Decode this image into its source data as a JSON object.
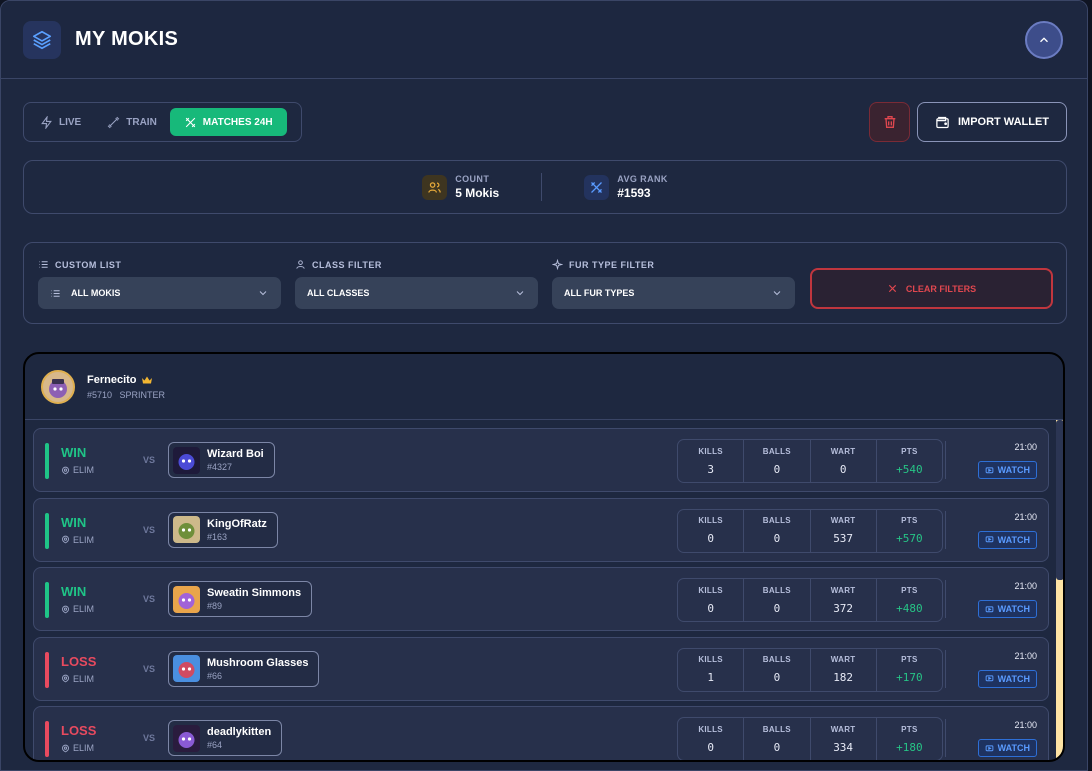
{
  "header": {
    "title": "MY MOKIS",
    "logo_icon": "layers-icon",
    "collapse_icon": "chevron-up-icon"
  },
  "toolbar": {
    "tabs": [
      {
        "label": "LIVE",
        "icon": "bolt-icon",
        "active": false
      },
      {
        "label": "TRAIN",
        "icon": "dumbbell-icon",
        "active": false
      },
      {
        "label": "MATCHES 24H",
        "icon": "swords-icon",
        "active": true
      }
    ],
    "delete_icon": "trash-icon",
    "import_label": "IMPORT WALLET",
    "import_icon": "wallet-icon"
  },
  "stats": {
    "count_label": "COUNT",
    "count_value": "5 Mokis",
    "rank_label": "AVG RANK",
    "rank_value": "#1593"
  },
  "filters": {
    "custom_list": {
      "label": "CUSTOM LIST",
      "value": "ALL MOKIS"
    },
    "class_filter": {
      "label": "CLASS FILTER",
      "value": "ALL CLASSES"
    },
    "fur_filter": {
      "label": "FUR TYPE FILTER",
      "value": "ALL FUR TYPES"
    },
    "clear_label": "CLEAR FILTERS"
  },
  "moki": {
    "name": "Fernecito",
    "id": "#5710",
    "class": "SPRINTER"
  },
  "columns": {
    "kills": "KILLS",
    "balls": "BALLS",
    "wart": "WART",
    "pts": "PTS"
  },
  "common": {
    "vs": "VS",
    "watch": "WATCH"
  },
  "matches": [
    {
      "result": "WIN",
      "mode": "ELIM",
      "opponent": "Wizard Boi",
      "opp_id": "#4327",
      "kills": "3",
      "balls": "0",
      "wart": "0",
      "pts": "+540",
      "time": "21:00"
    },
    {
      "result": "WIN",
      "mode": "ELIM",
      "opponent": "KingOfRatz",
      "opp_id": "#163",
      "kills": "0",
      "balls": "0",
      "wart": "537",
      "pts": "+570",
      "time": "21:00"
    },
    {
      "result": "WIN",
      "mode": "ELIM",
      "opponent": "Sweatin Simmons",
      "opp_id": "#89",
      "kills": "0",
      "balls": "0",
      "wart": "372",
      "pts": "+480",
      "time": "21:00"
    },
    {
      "result": "LOSS",
      "mode": "ELIM",
      "opponent": "Mushroom Glasses",
      "opp_id": "#66",
      "kills": "1",
      "balls": "0",
      "wart": "182",
      "pts": "+170",
      "time": "21:00"
    },
    {
      "result": "LOSS",
      "mode": "ELIM",
      "opponent": "deadlykitten",
      "opp_id": "#64",
      "kills": "0",
      "balls": "0",
      "wart": "334",
      "pts": "+180",
      "time": "21:00"
    }
  ],
  "colors": {
    "win": "#1fc487",
    "loss": "#e84a5f",
    "accent": "#17b97a",
    "danger": "#c0363e"
  }
}
